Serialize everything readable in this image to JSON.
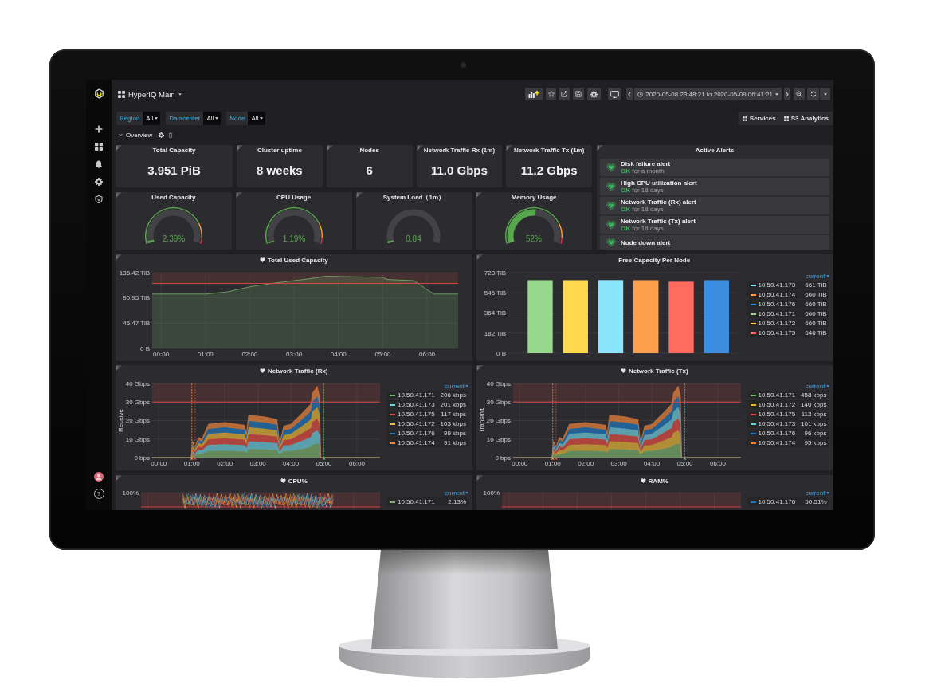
{
  "sidebar": {
    "help": "?"
  },
  "dashboard": {
    "title": "HyperIQ Main",
    "time_range": "2020-05-08 23:48:21 to 2020-05-09 06:41:21"
  },
  "variables": [
    {
      "label": "Region",
      "value": "All"
    },
    {
      "label": "Datacenter",
      "value": "All"
    },
    {
      "label": "Node",
      "value": "All"
    }
  ],
  "links": [
    "Services",
    "S3 Analytics"
  ],
  "row": {
    "title": "Overview",
    "expanded": true
  },
  "stats": [
    {
      "title": "Total Capacity",
      "value": "3.951 PiB"
    },
    {
      "title": "Cluster uptime",
      "value": "8 weeks"
    },
    {
      "title": "Nodes",
      "value": "6"
    },
    {
      "title": "Network Traffic Rx (1m)",
      "value": "11.0 Gbps"
    },
    {
      "title": "Network Traffic Tx (1m)",
      "value": "11.2 Gbps"
    }
  ],
  "gauges": [
    {
      "title": "Used Capacity",
      "value": "2.39%",
      "level": 0.0239,
      "threshold_band": true
    },
    {
      "title": "CPU Usage",
      "value": "1.19%",
      "level": 0.0119,
      "threshold_band": true
    },
    {
      "title": "System Load（1m）",
      "value": "0.84",
      "level": 0.02
    },
    {
      "title": "Memory Usage",
      "value": "52%",
      "level": 0.52,
      "threshold_band": true
    }
  ],
  "alerts": {
    "title": "Active Alerts",
    "items": [
      {
        "name": "Disk failure alert",
        "ok": true,
        "state": "OK",
        "duration": "for a month"
      },
      {
        "name": "High CPU utilization alert",
        "ok": true,
        "state": "OK",
        "duration": "for 18 days"
      },
      {
        "name": "Network Traffic (Rx) alert",
        "ok": true,
        "state": "OK",
        "duration": "for 18 days"
      },
      {
        "name": "Network Traffic (Tx) alert",
        "ok": true,
        "state": "OK",
        "duration": "for 18 days"
      },
      {
        "name": "Node down alert",
        "ok": true
      }
    ]
  },
  "graphs": [
    {
      "title": "Total Used Capacity",
      "alert": true,
      "chart_data": {
        "type": "area",
        "grid": true,
        "x": [
          -0.2,
          1.0,
          1.5,
          2.0,
          2.5,
          3.0,
          3.5,
          3.7,
          5.0,
          5.1,
          5.7,
          6.0,
          6.15,
          6.7
        ],
        "series": [
          {
            "color": "#7eb26d",
            "values": [
              98,
              98,
              102,
              111,
              117,
              122,
              127,
              130,
              128,
              124,
              122,
              106,
              98,
              98
            ]
          }
        ],
        "xlim": [
          -0.2,
          6.7
        ],
        "ylim": [
          0,
          136.42
        ],
        "xticks": [
          {
            "value": 0,
            "label": "00:00"
          },
          {
            "value": 1,
            "label": "01:00"
          },
          {
            "value": 2,
            "label": "02:00"
          },
          {
            "value": 3,
            "label": "03:00"
          },
          {
            "value": 4,
            "label": "04:00"
          },
          {
            "value": 5,
            "label": "05:00"
          },
          {
            "value": 6,
            "label": "06:00"
          }
        ],
        "yticks": [
          {
            "value": 0,
            "label": "0 B"
          },
          {
            "value": 45.47,
            "label": "45.47 TiB"
          },
          {
            "value": 90.95,
            "label": "90.95 TiB"
          },
          {
            "value": 136.42,
            "label": "136.42 TiB"
          }
        ],
        "ref_lines": [
          {
            "axis": "y",
            "value": 117,
            "color": "#e24d42"
          }
        ],
        "bands": [
          {
            "axis": "y",
            "from": 117,
            "to": 136.42,
            "color": "#e24d42"
          }
        ]
      }
    },
    {
      "title": "Free Capacity Per Node",
      "chart_data": {
        "type": "bar",
        "grid": true,
        "series": [
          {
            "color": "#96d98d",
            "values": [
              660
            ]
          },
          {
            "color": "#ffd84f",
            "values": [
              660
            ]
          },
          {
            "color": "#8ae6fb",
            "values": [
              661
            ]
          },
          {
            "color": "#ffa04f",
            "values": [
              660
            ]
          },
          {
            "color": "#ff6b5e",
            "values": [
              646
            ]
          },
          {
            "color": "#3c8fe0",
            "values": [
              660
            ]
          }
        ],
        "ylim": [
          0,
          728
        ],
        "yticks": [
          {
            "value": 0,
            "label": "0 B"
          },
          {
            "value": 182,
            "label": "182 TiB"
          },
          {
            "value": 364,
            "label": "364 TiB"
          },
          {
            "value": 546,
            "label": "546 TiB"
          },
          {
            "value": 728,
            "label": "728 TiB"
          }
        ]
      },
      "legend": {
        "header": "current",
        "rows": [
          {
            "name": "10.50.41.173",
            "value": "661 TiB",
            "color": "#8ae6fb"
          },
          {
            "name": "10.50.41.174",
            "value": "660 TiB",
            "color": "#ffa04f"
          },
          {
            "name": "10.50.41.176",
            "value": "660 TiB",
            "color": "#3c8fe0"
          },
          {
            "name": "10.50.41.171",
            "value": "660 TiB",
            "color": "#96d98d"
          },
          {
            "name": "10.50.41.172",
            "value": "660 TiB",
            "color": "#ffd84f"
          },
          {
            "name": "10.50.41.175",
            "value": "646 TiB",
            "color": "#ff6b5e"
          }
        ]
      }
    },
    {
      "title": "Network Traffic (Rx)",
      "alert": true,
      "chart_data": {
        "type": "area",
        "stacked": true,
        "grid": true,
        "ylabel": "Receive",
        "x": [
          -0.2,
          0.98,
          1.02,
          1.1,
          1.2,
          1.3,
          1.5,
          2.0,
          2.6,
          2.65,
          2.72,
          3.2,
          3.58,
          3.66,
          3.78,
          4.0,
          4.4,
          4.6,
          4.66,
          4.8,
          4.87,
          4.9,
          6.7
        ],
        "series": [
          {
            "color": "#7eb26d",
            "values": [
              0,
              0,
              1.8,
              1.2,
              2.2,
              2,
              3.6,
              3.8,
              3.5,
              2.6,
              4.6,
              4.4,
              4.1,
              1.6,
              3.4,
              3.6,
              5,
              5.8,
              7,
              7.7,
              6.6,
              0,
              0
            ]
          },
          {
            "color": "#6ed0e0",
            "values": [
              0,
              0,
              1.6,
              1.1,
              2,
              1.8,
              3.2,
              3.4,
              3.2,
              2.3,
              4.1,
              4,
              3.7,
              1.4,
              3.1,
              3.2,
              4.5,
              5.2,
              6.3,
              6.9,
              5.9,
              0,
              0
            ]
          },
          {
            "color": "#e24d42",
            "values": [
              0,
              0,
              1.5,
              1,
              1.9,
              1.7,
              3.1,
              3.2,
              3,
              2.2,
              3.9,
              3.7,
              3.5,
              1.4,
              2.9,
              3.1,
              4.3,
              4.9,
              6,
              6.5,
              5.6,
              0,
              0
            ]
          },
          {
            "color": "#eab839",
            "values": [
              0,
              0,
              1.4,
              1,
              1.8,
              1.6,
              2.9,
              3,
              2.8,
              2.1,
              3.7,
              3.5,
              3.3,
              1.3,
              2.7,
              2.9,
              4,
              4.6,
              5.6,
              6.2,
              5.3,
              0,
              0
            ]
          },
          {
            "color": "#1f78c1",
            "values": [
              0,
              0,
              1.4,
              0.9,
              1.6,
              1.5,
              2.7,
              2.9,
              2.6,
              2,
              3.5,
              3.3,
              3.1,
              1.2,
              2.6,
              2.7,
              3.8,
              4.4,
              5.3,
              5.8,
              5,
              0,
              0
            ]
          },
          {
            "color": "#ef843c",
            "values": [
              0,
              0,
              1.3,
              0.8,
              1.5,
              1.4,
              2.5,
              2.7,
              2.4,
              1.8,
              3.2,
              3.1,
              2.9,
              1.1,
              2.4,
              2.5,
              3.5,
              4.1,
              4.9,
              5.4,
              4.6,
              0,
              0
            ]
          }
        ],
        "xlim": [
          -0.2,
          6.7
        ],
        "ylim": [
          0,
          40
        ],
        "xticks": [
          {
            "value": 0,
            "label": "00:00"
          },
          {
            "value": 1,
            "label": "01:00"
          },
          {
            "value": 2,
            "label": "02:00"
          },
          {
            "value": 3,
            "label": "03:00"
          },
          {
            "value": 4,
            "label": "04:00"
          },
          {
            "value": 5,
            "label": "05:00"
          },
          {
            "value": 6,
            "label": "06:00"
          }
        ],
        "yticks": [
          {
            "value": 0,
            "label": "0 bps"
          },
          {
            "value": 10,
            "label": "10 Gbps"
          },
          {
            "value": 20,
            "label": "20 Gbps"
          },
          {
            "value": 30,
            "label": "30 Gbps"
          },
          {
            "value": 40,
            "label": "40 Gbps"
          }
        ],
        "ref_lines": [
          {
            "axis": "y",
            "value": 30,
            "color": "#e24d42"
          },
          {
            "axis": "x",
            "value": 1.0,
            "color": "#ff9830"
          },
          {
            "axis": "x",
            "value": 1.1,
            "color": "#e24d42"
          },
          {
            "axis": "x",
            "value": 5.0,
            "color": "#73bf69"
          }
        ],
        "bands": [
          {
            "axis": "y",
            "from": 30,
            "to": 40,
            "color": "#e24d42"
          }
        ]
      },
      "legend": {
        "header": "current",
        "rows": [
          {
            "name": "10.50.41.171",
            "value": "206 kbps",
            "color": "#7eb26d"
          },
          {
            "name": "10.50.41.173",
            "value": "201 kbps",
            "color": "#6ed0e0"
          },
          {
            "name": "10.50.41.175",
            "value": "117 kbps",
            "color": "#e24d42"
          },
          {
            "name": "10.50.41.172",
            "value": "103 kbps",
            "color": "#eab839"
          },
          {
            "name": "10.50.41.176",
            "value": "99 kbps",
            "color": "#1f78c1"
          },
          {
            "name": "10.50.41.174",
            "value": "91 kbps",
            "color": "#ef843c"
          }
        ]
      }
    },
    {
      "title": "Network Traffic (Tx)",
      "alert": true,
      "chart_data": {
        "type": "area",
        "stacked": true,
        "grid": true,
        "ylabel": "Transmit",
        "x": [
          -0.2,
          0.98,
          1.02,
          1.1,
          1.2,
          1.3,
          1.5,
          2.0,
          2.6,
          2.65,
          2.72,
          3.2,
          3.58,
          3.66,
          3.78,
          4.0,
          4.4,
          4.6,
          4.66,
          4.8,
          4.87,
          4.9,
          6.7
        ],
        "series": [
          {
            "color": "#7eb26d",
            "values": [
              0,
              0,
              1.8,
              1.2,
              2.2,
              2,
              3.6,
              3.8,
              3.5,
              2.6,
              4.6,
              4.4,
              4.1,
              1.6,
              3.4,
              3.6,
              5,
              5.8,
              7,
              7.7,
              6.6,
              0,
              0
            ]
          },
          {
            "color": "#eab839",
            "values": [
              0,
              0,
              1.6,
              1.1,
              2,
              1.8,
              3.2,
              3.4,
              3.2,
              2.3,
              4.1,
              4,
              3.7,
              1.4,
              3.1,
              3.2,
              4.5,
              5.2,
              6.3,
              6.9,
              5.9,
              0,
              0
            ]
          },
          {
            "color": "#e24d42",
            "values": [
              0,
              0,
              1.5,
              1,
              1.9,
              1.7,
              3.1,
              3.2,
              3,
              2.2,
              3.9,
              3.7,
              3.5,
              1.4,
              2.9,
              3.1,
              4.3,
              4.9,
              6,
              6.5,
              5.6,
              0,
              0
            ]
          },
          {
            "color": "#6ed0e0",
            "values": [
              0,
              0,
              1.4,
              1,
              1.8,
              1.6,
              2.9,
              3,
              2.8,
              2.1,
              3.7,
              3.5,
              3.3,
              1.3,
              2.7,
              2.9,
              4,
              4.6,
              5.6,
              6.2,
              5.3,
              0,
              0
            ]
          },
          {
            "color": "#1f78c1",
            "values": [
              0,
              0,
              1.4,
              0.9,
              1.6,
              1.5,
              2.7,
              2.9,
              2.6,
              2,
              3.5,
              3.3,
              3.1,
              1.2,
              2.6,
              2.7,
              3.8,
              4.4,
              5.3,
              5.8,
              5,
              0,
              0
            ]
          },
          {
            "color": "#ef843c",
            "values": [
              0,
              0,
              1.3,
              0.8,
              1.5,
              1.4,
              2.5,
              2.7,
              2.4,
              1.8,
              3.2,
              3.1,
              2.9,
              1.1,
              2.4,
              2.5,
              3.5,
              4.1,
              4.9,
              5.4,
              4.6,
              0,
              0
            ]
          }
        ],
        "xlim": [
          -0.2,
          6.7
        ],
        "ylim": [
          0,
          40
        ],
        "xticks": [
          {
            "value": 0,
            "label": "00:00"
          },
          {
            "value": 1,
            "label": "01:00"
          },
          {
            "value": 2,
            "label": "02:00"
          },
          {
            "value": 3,
            "label": "03:00"
          },
          {
            "value": 4,
            "label": "04:00"
          },
          {
            "value": 5,
            "label": "05:00"
          },
          {
            "value": 6,
            "label": "06:00"
          }
        ],
        "yticks": [
          {
            "value": 0,
            "label": "0 bps"
          },
          {
            "value": 10,
            "label": "10 Gbps"
          },
          {
            "value": 20,
            "label": "20 Gbps"
          },
          {
            "value": 30,
            "label": "30 Gbps"
          },
          {
            "value": 40,
            "label": "40 Gbps"
          }
        ],
        "ref_lines": [
          {
            "axis": "y",
            "value": 30,
            "color": "#e24d42"
          },
          {
            "axis": "x",
            "value": 1.0,
            "color": "#ff9830"
          },
          {
            "axis": "x",
            "value": 1.1,
            "color": "#e24d42"
          },
          {
            "axis": "x",
            "value": 5.0,
            "color": "#73bf69"
          }
        ],
        "bands": [
          {
            "axis": "y",
            "from": 30,
            "to": 40,
            "color": "#e24d42"
          }
        ]
      },
      "legend": {
        "header": "current",
        "rows": [
          {
            "name": "10.50.41.171",
            "value": "458 kbps",
            "color": "#7eb26d"
          },
          {
            "name": "10.50.41.172",
            "value": "140 kbps",
            "color": "#eab839"
          },
          {
            "name": "10.50.41.175",
            "value": "113 kbps",
            "color": "#e24d42"
          },
          {
            "name": "10.50.41.173",
            "value": "101 kbps",
            "color": "#6ed0e0"
          },
          {
            "name": "10.50.41.176",
            "value": "96 kbps",
            "color": "#1f78c1"
          },
          {
            "name": "10.50.41.174",
            "value": "95 kbps",
            "color": "#ef843c"
          }
        ]
      }
    },
    {
      "title": "CPU%",
      "alert": true,
      "axis_label": "100%",
      "traces": true,
      "legend": {
        "header": "current",
        "rows": [
          {
            "name": "10.50.41.171",
            "value": "2.13%",
            "color": "#7eb26d"
          }
        ]
      }
    },
    {
      "title": "RAM%",
      "alert": true,
      "axis_label": "100%",
      "legend": {
        "header": "current",
        "rows": [
          {
            "name": "10.50.41.176",
            "value": "50.51%",
            "color": "#1f78c1"
          }
        ]
      }
    }
  ]
}
